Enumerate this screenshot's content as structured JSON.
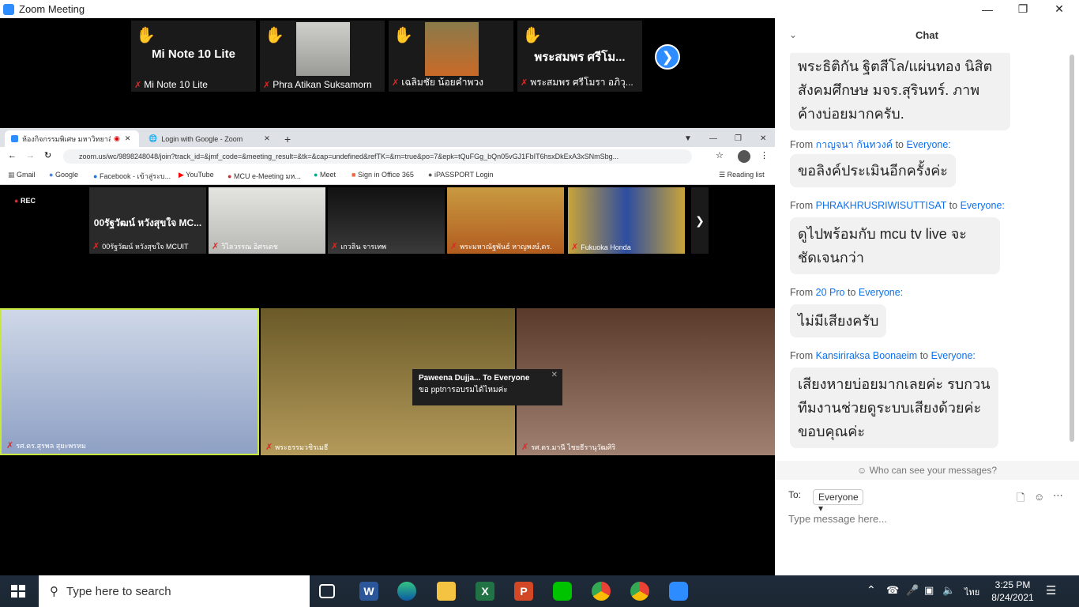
{
  "window": {
    "title": "Zoom Meeting"
  },
  "top_thumbs": [
    {
      "big": "Mi Note 10 Lite",
      "label": "Mi Note 10 Lite"
    },
    {
      "big": "",
      "label": "Phra Atikan Suksamorn"
    },
    {
      "big": "",
      "label": "เฉลิมชัย น้อยคำพวง"
    },
    {
      "big": "พระสมพร ศรีโม...",
      "label": "พระสมพร ศรีโมรา อภิวุ..."
    }
  ],
  "browser": {
    "tabs": [
      "ห้องกิจกรรมพิเศษ มหาวิทยาลัยมหา...",
      "Login with Google - Zoom"
    ],
    "url": "zoom.us/wc/9898248048/join?track_id=&jmf_code=&meeting_result=&tk=&cap=undefined&refTK=&rn=true&po=7&epk=tQuFGg_bQn05vGJ1FbIT6hsxDkExA3xSNmSbg...",
    "bookmarks": [
      "Gmail",
      "Google",
      "Facebook - เข้าสู่ระบ...",
      "YouTube",
      "MCU e-Meeting มห...",
      "Meet",
      "Sign in Office 365",
      "iPASSPORT Login"
    ],
    "reading_list": "Reading list"
  },
  "inner": {
    "rec": "REC",
    "thumbs": [
      {
        "big": "00รัฐวัฒน์ หวังสุขใจ MC...",
        "label": "00รัฐวัฒน์ หวังสุขใจ MCUIT"
      },
      {
        "big": "",
        "label": "วิไลวรรณ อิศรเดช"
      },
      {
        "big": "",
        "label": "เกวลิน จารเทพ"
      },
      {
        "big": "",
        "label": "พระมหาณัฐพันธ์ หาญพงษ์,ดร."
      },
      {
        "big": "",
        "label": "Fukuoka Honda"
      }
    ],
    "videos": [
      {
        "label": "รศ.ดร.สุรพล สุยะพรหม"
      },
      {
        "label": "พระธรรมวชิรเมธี"
      },
      {
        "label": "รศ.ดร.มานี ไชยธีรานุวัฒศิริ"
      }
    ],
    "toast": {
      "title": "Paweena Dujja... To Everyone",
      "text": "ขอ pptการอบรมได้ไหมค่ะ"
    }
  },
  "chat": {
    "header": "Chat",
    "messages": [
      {
        "from": "",
        "to": "",
        "text": "พระธิติกัน ฐิตสีโล/แผ่นทอง นิสิตสังคมศึกษษ มจร.สุรินทร์. ภาพค้างบ่อยมากครับ."
      },
      {
        "from": "กาญจนา กันทวงค์",
        "to": "Everyone:",
        "text": "ขอลิงค์ประเมินอีกครั้งค่ะ"
      },
      {
        "from": "PHRAKHRUSRIWISUTTISAT",
        "to": "Everyone:",
        "text": "ดูไปพร้อมกับ mcu tv live จะชัดเจนกว่า"
      },
      {
        "from": "20 Pro",
        "to": "Everyone:",
        "text": "ไม่มีเสียงครับ"
      },
      {
        "from": "Kansiriraksa Boonaeim",
        "to": "Everyone:",
        "text": "เสียงหายบ่อยมากเลยค่ะ รบกวนทีมงานช่วยดูระบบเสียงด้วยค่ะ ขอบคุณค่ะ"
      }
    ],
    "from_word": "From",
    "to_word": "to",
    "who_can_see": "Who can see your messages?",
    "to_label": "To:",
    "to_value": "Everyone",
    "placeholder": "Type message here..."
  },
  "taskbar": {
    "search": "Type here to search",
    "lang": "ไทย",
    "time": "3:25 PM",
    "date": "8/24/2021"
  }
}
